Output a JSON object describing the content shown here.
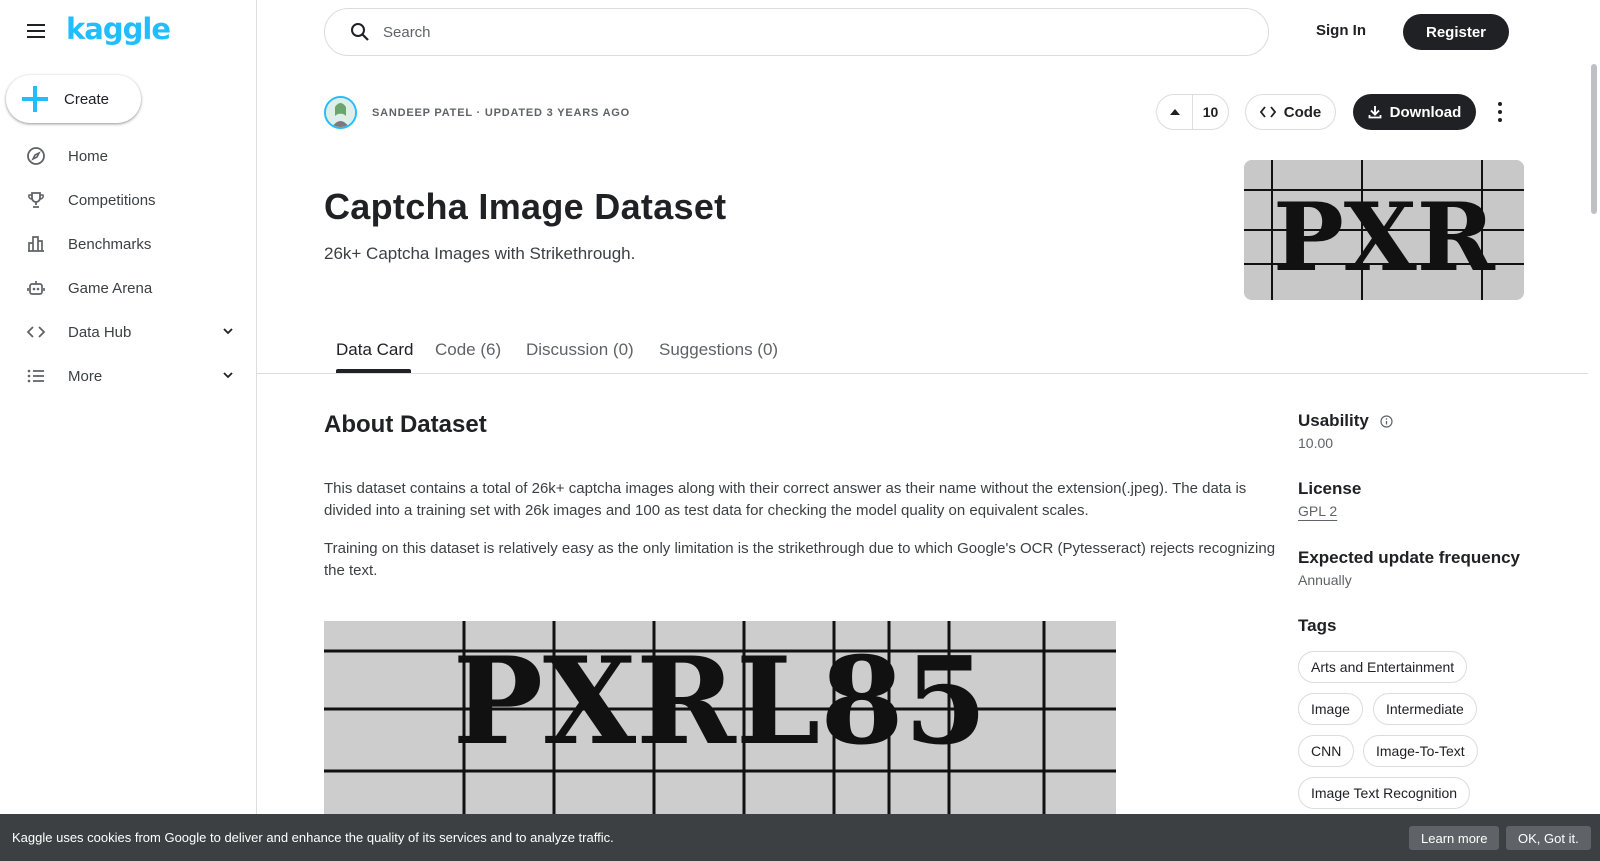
{
  "sidebar": {
    "logo": "kaggle",
    "create_label": "Create",
    "items": [
      {
        "label": "Home",
        "icon": "compass-icon"
      },
      {
        "label": "Competitions",
        "icon": "trophy-icon"
      },
      {
        "label": "Benchmarks",
        "icon": "bar-chart-icon"
      },
      {
        "label": "Game Arena",
        "icon": "robot-icon"
      },
      {
        "label": "Data Hub",
        "icon": "code-icon"
      },
      {
        "label": "More",
        "icon": "list-icon"
      }
    ]
  },
  "topbar": {
    "search_placeholder": "Search",
    "signin": "Sign In",
    "register": "Register"
  },
  "dataset": {
    "meta": "SANDEEP PATEL · UPDATED 3 YEARS AGO",
    "votes": "10",
    "code_label": "Code",
    "download_label": "Download",
    "title": "Captcha Image Dataset",
    "subtitle": "26k+ Captcha Images with Strikethrough.",
    "cover_text": "PXR"
  },
  "tabs": [
    {
      "label": "Data Card"
    },
    {
      "label": "Code (6)"
    },
    {
      "label": "Discussion (0)"
    },
    {
      "label": "Suggestions (0)"
    }
  ],
  "about": {
    "heading": "About Dataset",
    "para1": "This dataset contains a total of 26k+ captcha images along with their correct answer as their name without the extension(.jpeg). The data is divided into a training set with 26k images and 100 as test data for checking the model quality on equivalent scales.",
    "para2": "Training on this dataset is relatively easy as the only limitation is the strikethrough due to which Google's OCR (Pytesseract) rejects recognizing the text.",
    "image_text": "PXRL85"
  },
  "details": {
    "usability_label": "Usability",
    "usability_value": "10.00",
    "license_label": "License",
    "license_value": "GPL 2",
    "frequency_label": "Expected update frequency",
    "frequency_value": "Annually",
    "tags_label": "Tags",
    "tags": [
      "Arts and Entertainment",
      "Image",
      "Intermediate",
      "CNN",
      "Image-To-Text",
      "Image Text Recognition"
    ]
  },
  "cookie": {
    "text": "Kaggle uses cookies from Google to deliver and enhance the quality of its services and to analyze traffic.",
    "learn_more": "Learn more",
    "ok": "OK, Got it."
  },
  "colors": {
    "brand": "#20beff",
    "primary_button": "#202124"
  }
}
